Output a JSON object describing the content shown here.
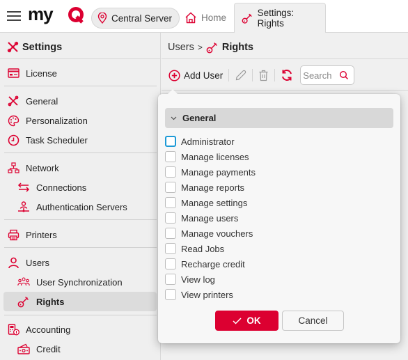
{
  "colors": {
    "accent": "#dc0031",
    "focus": "#1d9ad6"
  },
  "topbar": {
    "menu_icon": "hamburger-icon",
    "logo_text": "myQ",
    "server_label": "Central Server",
    "tabs": [
      {
        "label": "Home",
        "icon": "home-icon",
        "active": false
      },
      {
        "label": "Settings: Rights",
        "icon": "key-icon",
        "active": true
      }
    ]
  },
  "sidebar": {
    "title": "Settings",
    "items": [
      {
        "label": "License",
        "icon": "license-card-icon",
        "level": 0
      },
      {
        "label": "General",
        "icon": "tools-icon",
        "level": 0
      },
      {
        "label": "Personalization",
        "icon": "palette-icon",
        "level": 0
      },
      {
        "label": "Task Scheduler",
        "icon": "clock-icon",
        "level": 0
      },
      {
        "label": "Network",
        "icon": "network-icon",
        "level": 0
      },
      {
        "label": "Connections",
        "icon": "arrows-exchange-icon",
        "level": 1
      },
      {
        "label": "Authentication Servers",
        "icon": "auth-server-icon",
        "level": 1
      },
      {
        "label": "Printers",
        "icon": "printer-icon",
        "level": 0
      },
      {
        "label": "Users",
        "icon": "user-icon",
        "level": 0
      },
      {
        "label": "User Synchronization",
        "icon": "users-group-icon",
        "level": 1
      },
      {
        "label": "Rights",
        "icon": "key-icon",
        "level": 1,
        "selected": true
      },
      {
        "label": "Accounting",
        "icon": "accounting-icon",
        "level": 0
      },
      {
        "label": "Credit",
        "icon": "credit-icon",
        "level": 1
      }
    ]
  },
  "main": {
    "breadcrumb": {
      "parent": "Users",
      "separator": ">",
      "current": "Rights"
    },
    "toolbar": {
      "add_user": "Add User",
      "search_placeholder": "Search"
    }
  },
  "popup": {
    "group_label": "General",
    "permissions": [
      {
        "label": "Administrator",
        "checked": false,
        "focused": true
      },
      {
        "label": "Manage licenses",
        "checked": false
      },
      {
        "label": "Manage payments",
        "checked": false
      },
      {
        "label": "Manage reports",
        "checked": false
      },
      {
        "label": "Manage settings",
        "checked": false
      },
      {
        "label": "Manage users",
        "checked": false
      },
      {
        "label": "Manage vouchers",
        "checked": false
      },
      {
        "label": "Read Jobs",
        "checked": false
      },
      {
        "label": "Recharge credit",
        "checked": false
      },
      {
        "label": "View log",
        "checked": false
      },
      {
        "label": "View printers",
        "checked": false
      }
    ],
    "ok_label": "OK",
    "cancel_label": "Cancel"
  }
}
